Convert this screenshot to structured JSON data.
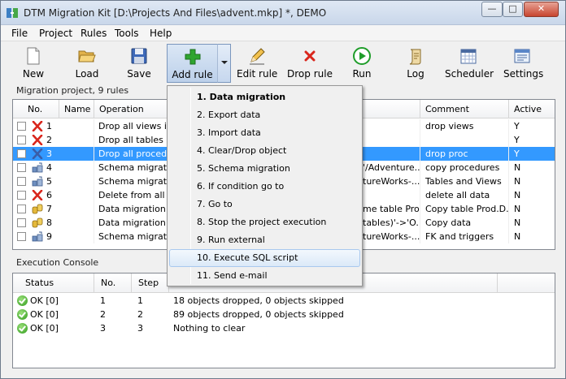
{
  "window": {
    "title": "DTM Migration Kit [D:\\Projects And Files\\advent.mkp] *, DEMO"
  },
  "menu": [
    "File",
    "Project",
    "Rules",
    "Tools",
    "Help"
  ],
  "toolbar": {
    "new": "New",
    "load": "Load",
    "save": "Save",
    "add_rule": "Add rule",
    "edit_rule": "Edit rule",
    "drop_rule": "Drop rule",
    "run": "Run",
    "log": "Log",
    "scheduler": "Scheduler",
    "settings": "Settings"
  },
  "project": {
    "caption": "Migration project, 9 rules",
    "columns": {
      "no": "No.",
      "name": "Name",
      "operation": "Operation",
      "comment": "Comment",
      "active": "Active"
    },
    "rows": [
      {
        "no": "1",
        "icon": "drop-icon",
        "operation": "Drop all views in (",
        "op_tail": "",
        "comment": "drop views",
        "active": "Y",
        "selected": false
      },
      {
        "no": "2",
        "icon": "drop-icon",
        "operation": "Drop all tables in t",
        "op_tail": "",
        "comment": "",
        "active": "Y",
        "selected": false
      },
      {
        "no": "3",
        "icon": "drop-icon",
        "operation": "Drop all procedure",
        "op_tail": "",
        "comment": "drop proc",
        "active": "Y",
        "selected": true
      },
      {
        "no": "4",
        "icon": "schema-icon",
        "operation": "Schema migration",
        "op_tail": "'/Adventure...",
        "comment": "copy procedures",
        "active": "N",
        "selected": false
      },
      {
        "no": "5",
        "icon": "schema-icon",
        "operation": "Schema migration",
        "op_tail": "tureWorks-...",
        "comment": "Tables and Views",
        "active": "N",
        "selected": false
      },
      {
        "no": "6",
        "icon": "drop-icon",
        "operation": "Delete from all tab",
        "op_tail": "",
        "comment": "delete all data",
        "active": "N",
        "selected": false
      },
      {
        "no": "7",
        "icon": "data-icon",
        "operation": "Data migration: 'O",
        "op_tail": "me table Pro...",
        "comment": "Copy table Prod.D...",
        "active": "N",
        "selected": false
      },
      {
        "no": "8",
        "icon": "data-icon",
        "operation": "Data migration: 'O",
        "op_tail": "tables)'->'O...",
        "comment": "Copy data",
        "active": "N",
        "selected": false
      },
      {
        "no": "9",
        "icon": "schema-icon",
        "operation": "Schema migration",
        "op_tail": "tureWorks-...",
        "comment": "FK and triggers",
        "active": "N",
        "selected": false
      }
    ]
  },
  "console": {
    "caption": "Execution Console",
    "columns": {
      "status": "Status",
      "no": "No.",
      "step": "Step"
    },
    "rows": [
      {
        "status": "OK [0]",
        "no": "1",
        "step": "1",
        "message": "18 objects dropped, 0 objects skipped"
      },
      {
        "status": "OK [0]",
        "no": "2",
        "step": "2",
        "message": "89 objects dropped, 0 objects skipped"
      },
      {
        "status": "OK [0]",
        "no": "3",
        "step": "3",
        "message": "Nothing to clear"
      }
    ]
  },
  "add_rule_menu": [
    {
      "label": "1. Data migration",
      "bold": true
    },
    {
      "label": "2. Export data"
    },
    {
      "label": "3. Import data"
    },
    {
      "label": "4. Clear/Drop object"
    },
    {
      "label": "5. Schema migration"
    },
    {
      "label": "6. If condition go to"
    },
    {
      "label": "7. Go to"
    },
    {
      "label": "8. Stop the project execution"
    },
    {
      "label": "9. Run external"
    },
    {
      "label": "10. Execute SQL script",
      "hover": true
    },
    {
      "label": "11. Send e-mail"
    }
  ],
  "colors": {
    "selection": "#3399ff",
    "drop": "#d9261c",
    "run": "#1f9d2a",
    "add": "#2fa52f"
  }
}
